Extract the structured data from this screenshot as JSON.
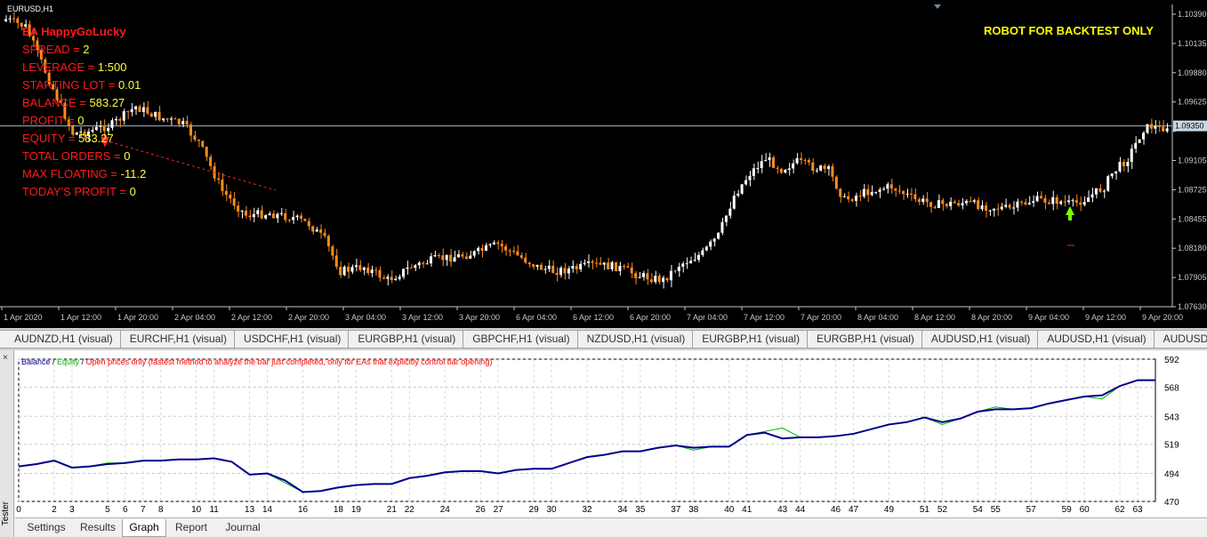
{
  "chart": {
    "symbol": "EURUSD,H1",
    "banner": "ROBOT FOR BACKTEST ONLY",
    "current_price": "1.09350",
    "ea_name": "EA HappyGoLucky",
    "info": [
      {
        "label": "SPREAD = ",
        "value": "2"
      },
      {
        "label": "LEVERAGE = ",
        "value": "1:500"
      },
      {
        "label": "STARTING LOT = ",
        "value": "0.01"
      },
      {
        "label": "BALANCE = ",
        "value": "583.27"
      },
      {
        "label": "PROFIT = ",
        "value": "0"
      },
      {
        "label": "EQUITY = ",
        "value": "583.27"
      },
      {
        "label": "TOTAL ORDERS = ",
        "value": "0"
      },
      {
        "label": "MAX FLOATING = ",
        "value": "-11.2"
      },
      {
        "label": "TODAY'S PROFIT = ",
        "value": "0"
      }
    ],
    "price_labels": [
      "1.10390",
      "1.10135",
      "1.09880",
      "1.09625",
      "1.09350",
      "1.09105",
      "1.08725",
      "1.08455",
      "1.08180",
      "1.07905",
      "1.07630"
    ],
    "time_labels": [
      "1 Apr 2020",
      "1 Apr 12:00",
      "1 Apr 20:00",
      "2 Apr 04:00",
      "2 Apr 12:00",
      "2 Apr 20:00",
      "3 Apr 04:00",
      "3 Apr 12:00",
      "3 Apr 20:00",
      "6 Apr 04:00",
      "6 Apr 12:00",
      "6 Apr 20:00",
      "7 Apr 04:00",
      "7 Apr 12:00",
      "7 Apr 20:00",
      "8 Apr 04:00",
      "8 Apr 12:00",
      "8 Apr 20:00",
      "9 Apr 04:00",
      "9 Apr 12:00",
      "9 Apr 20:00"
    ],
    "colors": {
      "bull": "#ffffff",
      "bear": "#ff8c1a",
      "grid": "#1a1a1a",
      "axis_text": "#c8c8c8",
      "price_line": "#9fb7c8"
    }
  },
  "tabs": [
    "AUDNZD,H1 (visual)",
    "EURCHF,H1 (visual)",
    "USDCHF,H1 (visual)",
    "EURGBP,H1 (visual)",
    "GBPCHF,H1 (visual)",
    "NZDUSD,H1 (visual)",
    "EURGBP,H1 (visual)",
    "EURGBP,H1 (visual)",
    "AUDUSD,H1 (visual)",
    "AUDUSD,H1 (visual)",
    "AUDUSD,H"
  ],
  "tester": {
    "side_label": "Tester",
    "close_glyph": "×",
    "legend": {
      "balance": "Balance",
      "sep1": " / ",
      "equity": "Equity",
      "sep2": " / ",
      "note": "Open prices only (fastest method to analyze the bar just completed, only for EAs that explicitly control bar opening)"
    },
    "y_labels": [
      "592",
      "568",
      "543",
      "519",
      "494",
      "470"
    ],
    "x_labels": [
      "0",
      "2",
      "3",
      "5",
      "6",
      "7",
      "8",
      "10",
      "11",
      "13",
      "14",
      "16",
      "18",
      "19",
      "21",
      "22",
      "24",
      "26",
      "27",
      "29",
      "30",
      "32",
      "34",
      "35",
      "37",
      "38",
      "40",
      "41",
      "43",
      "44",
      "46",
      "47",
      "49",
      "51",
      "52",
      "54",
      "55",
      "57",
      "59",
      "60",
      "62",
      "63"
    ],
    "tabs": [
      "Settings",
      "Results",
      "Graph",
      "Report",
      "Journal"
    ],
    "active_tab": "Graph",
    "colors": {
      "balance": "#00008b",
      "equity": "#00b000",
      "note": "#ff0000"
    }
  },
  "chart_data": {
    "type": "line",
    "x": [
      0,
      1,
      2,
      3,
      4,
      5,
      6,
      7,
      8,
      9,
      10,
      11,
      12,
      13,
      14,
      15,
      16,
      17,
      18,
      19,
      20,
      21,
      22,
      23,
      24,
      25,
      26,
      27,
      28,
      29,
      30,
      31,
      32,
      33,
      34,
      35,
      36,
      37,
      38,
      39,
      40,
      41,
      42,
      43,
      44,
      45,
      46,
      47,
      48,
      49,
      50,
      51,
      52,
      53,
      54,
      55,
      56,
      57,
      58,
      59,
      60,
      61,
      62,
      63,
      64
    ],
    "series": [
      {
        "name": "Balance",
        "values": [
          500,
          502,
          505,
          499,
          500,
          502,
          503,
          505,
          505,
          506,
          506,
          507,
          504,
          493,
          494,
          488,
          478,
          479,
          482,
          484,
          485,
          485,
          490,
          492,
          495,
          496,
          496,
          494,
          497,
          498,
          498,
          503,
          508,
          510,
          513,
          513,
          516,
          518,
          516,
          517,
          517,
          527,
          529,
          524,
          525,
          525,
          526,
          528,
          532,
          536,
          538,
          542,
          538,
          541,
          547,
          549,
          549,
          550,
          554,
          557,
          560,
          561,
          569,
          574,
          574
        ]
      },
      {
        "name": "Equity",
        "values": [
          500,
          502,
          505,
          499,
          500,
          503,
          503,
          505,
          505,
          506,
          506,
          507,
          504,
          493,
          494,
          486,
          478,
          479,
          482,
          484,
          485,
          485,
          490,
          492,
          495,
          496,
          496,
          494,
          497,
          498,
          498,
          503,
          508,
          510,
          513,
          513,
          516,
          518,
          514,
          517,
          517,
          527,
          530,
          533,
          525,
          525,
          526,
          528,
          532,
          536,
          538,
          542,
          536,
          541,
          547,
          551,
          549,
          550,
          554,
          557,
          560,
          558,
          569,
          574,
          574
        ]
      }
    ],
    "xlim": [
      0,
      64
    ],
    "ylim": [
      470,
      592
    ]
  }
}
